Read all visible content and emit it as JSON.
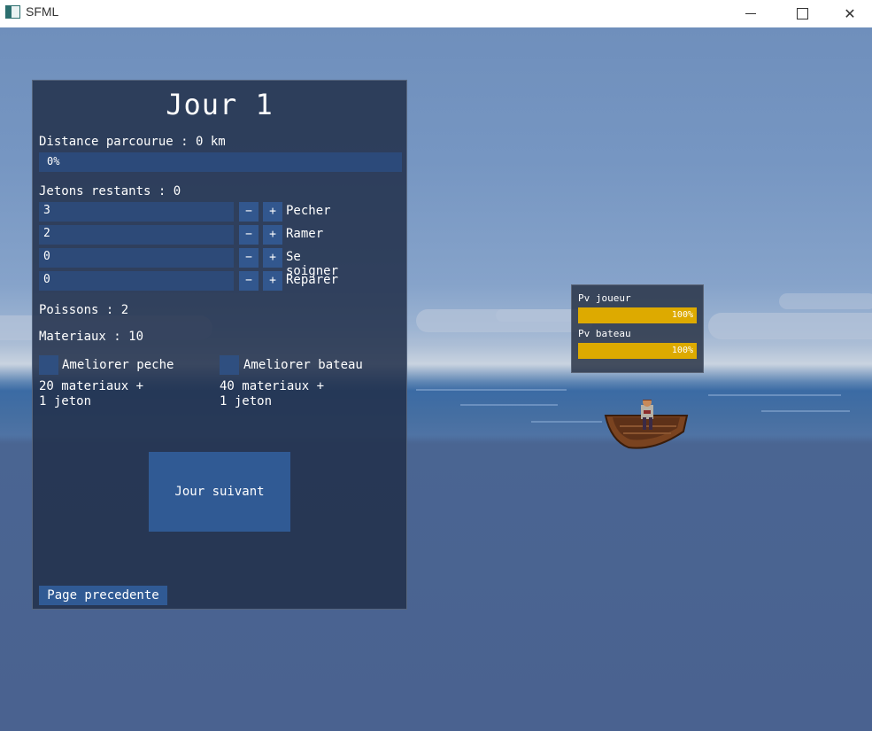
{
  "window": {
    "title": "SFML"
  },
  "panel": {
    "day_title": "Jour 1",
    "distance_label": "Distance parcourue : 0 km",
    "progress": {
      "value": 0,
      "text": "0%"
    },
    "tokens_label": "Jetons restants : 0",
    "actions": [
      {
        "value": "3",
        "label": "Pecher",
        "minus": "−",
        "plus": "+"
      },
      {
        "value": "2",
        "label": "Ramer",
        "minus": "−",
        "plus": "+"
      },
      {
        "value": "0",
        "label": "Se soigner",
        "minus": "−",
        "plus": "+"
      },
      {
        "value": "0",
        "label": "Reparer",
        "minus": "−",
        "plus": "+"
      }
    ],
    "fish_label": "Poissons : 2",
    "materials_label": "Materiaux : 10",
    "upgrades": [
      {
        "label": "Ameliorer peche",
        "cost_line1": "20 materiaux +",
        "cost_line2": "1 jeton"
      },
      {
        "label": "Ameliorer bateau",
        "cost_line1": "40 materiaux +",
        "cost_line2": "1 jeton"
      }
    ],
    "next_day_label": "Jour suivant",
    "prev_page_label": "Page precedente"
  },
  "hp": {
    "player_label": "Pv joueur",
    "player_value": 100,
    "player_text": "100%",
    "boat_label": "Pv bateau",
    "boat_value": 100,
    "boat_text": "100%",
    "bar_color": "#ddaa00"
  }
}
